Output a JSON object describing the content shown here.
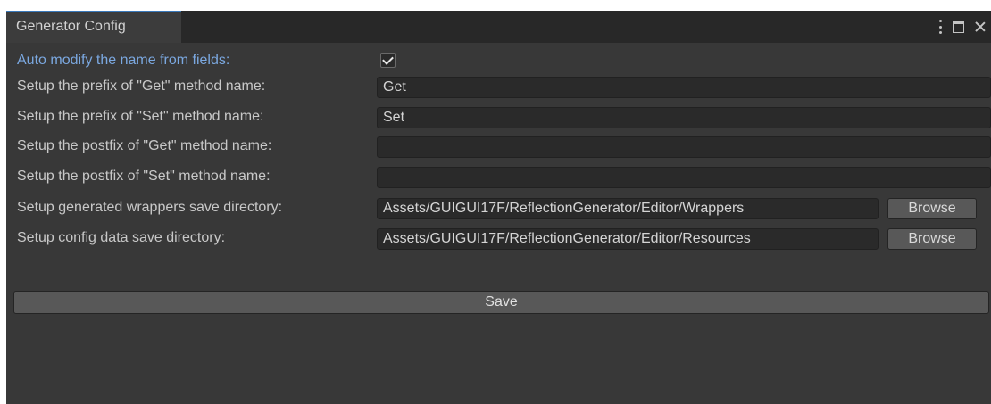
{
  "window": {
    "tab_title": "Generator Config"
  },
  "settings": {
    "auto_modify": {
      "label": "Auto modify the name from fields:",
      "checked": true
    },
    "get_prefix": {
      "label": "Setup the prefix of \"Get\" method name:",
      "value": "Get"
    },
    "set_prefix": {
      "label": "Setup the prefix of \"Set\" method name:",
      "value": "Set"
    },
    "get_postfix": {
      "label": "Setup the postfix of \"Get\" method name:",
      "value": ""
    },
    "set_postfix": {
      "label": "Setup the postfix of \"Set\" method name:",
      "value": ""
    },
    "wrappers_dir": {
      "label": "Setup generated wrappers save directory:",
      "value": "Assets/GUIGUI17F/ReflectionGenerator/Editor/Wrappers",
      "button": "Browse"
    },
    "config_dir": {
      "label": "Setup config data save directory:",
      "value": "Assets/GUIGUI17F/ReflectionGenerator/Editor/Resources",
      "button": "Browse"
    }
  },
  "actions": {
    "save_label": "Save"
  },
  "colors": {
    "background": "#383838",
    "tab_accent": "#3a79bb",
    "highlight_label": "#7ba8e0"
  },
  "icons": {
    "menu": "kebab-menu-icon",
    "maximize": "maximize-icon",
    "close": "close-icon",
    "check": "checkmark-icon"
  }
}
